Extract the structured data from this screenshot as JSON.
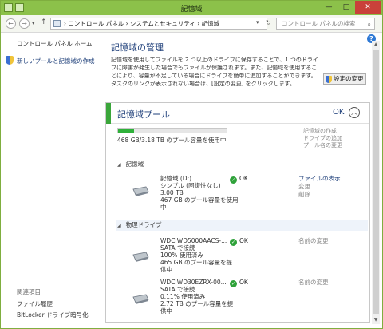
{
  "window": {
    "title": "記憶域"
  },
  "titlebar_buttons": {
    "minimize": "—",
    "maximize": "□",
    "close": "✕"
  },
  "address": {
    "path": "› コントロール パネル › システムとセキュリティ › 記憶域",
    "dropdown": "▾",
    "search_placeholder": "コントロール パネルの検索"
  },
  "nav": {
    "back": "←",
    "forward": "→",
    "recent": "▾",
    "up": "↑"
  },
  "sidebar": {
    "home": "コントロール パネル ホーム",
    "create_pool": "新しいプールと記憶域の作成",
    "related_heading": "関連項目",
    "file_history": "ファイル履歴",
    "bitlocker": "BitLocker ドライブ暗号化"
  },
  "main": {
    "title": "記憶域の管理",
    "description": "記憶域を使用してファイルを 2 つ以上のドライブに保存することで、1 つのドライブに障害が発生した場合でもファイルが保護されます。また、記憶域を使用することにより、容量が不足している場合にドライブを簡単に追加することができます。タスクのリンクが表示されない場合は、[設定の変更] をクリックします。",
    "change_settings": "設定の変更"
  },
  "pool": {
    "title": "記憶域プール",
    "status": "OK",
    "used_fraction": 0.147,
    "usage_text": "468 GB/3.18 TB のプール容量を使用中",
    "actions": [
      "記憶域の作成",
      "ドライブの追加",
      "プール名の変更"
    ]
  },
  "storage_spaces": {
    "heading": "記憶域",
    "items": [
      {
        "name": "記憶域 (D:)",
        "type": "シンプル (回復性なし)",
        "size": "3.00 TB",
        "usage_line1": "467 GB のプール容量を使用",
        "usage_line2": "中",
        "status": "OK",
        "links": [
          "ファイルの表示",
          "変更",
          "削除"
        ]
      }
    ]
  },
  "physical_drives": {
    "heading": "物理ドライブ",
    "items": [
      {
        "name": "WDC WD5000AACS-...",
        "connection": "SATA で接続",
        "used": "100% 使用済み",
        "pool_line1": "465 GB のプール容量を提",
        "pool_line2": "供中",
        "status": "OK",
        "link": "名前の変更"
      },
      {
        "name": "WDC WD30EZRX-00...",
        "connection": "SATA で接続",
        "used": "0.11% 使用済み",
        "pool_line1": "2.72 TB のプール容量を提",
        "pool_line2": "供中",
        "status": "OK",
        "link": "名前の変更"
      }
    ]
  },
  "colors": {
    "accent_green": "#8cc14a",
    "ok_green": "#2fa23a",
    "link_blue": "#1e3f7a"
  }
}
